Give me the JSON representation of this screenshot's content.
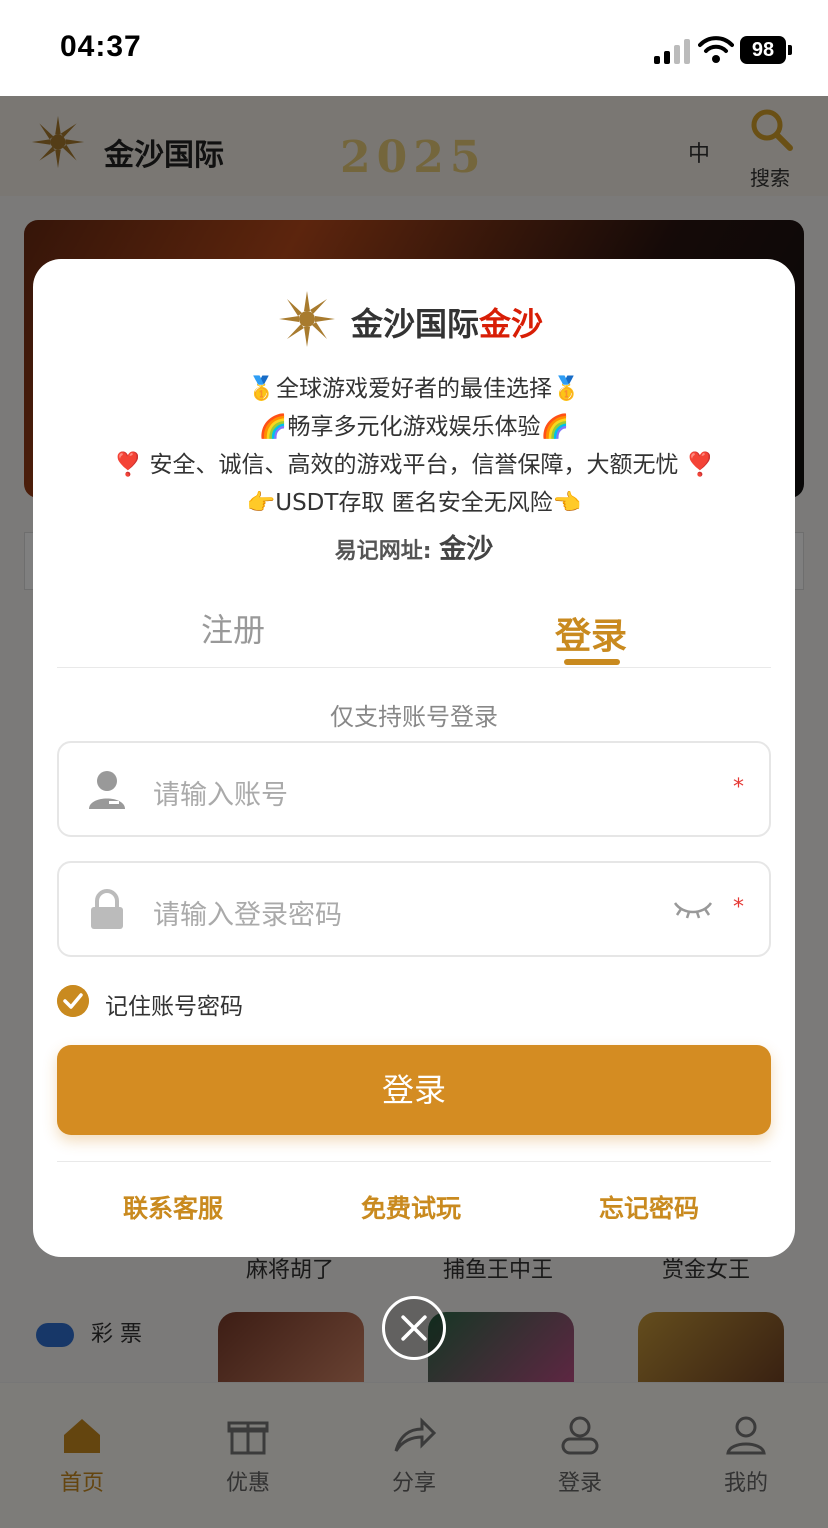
{
  "status_bar": {
    "time": "04:37",
    "battery": "98"
  },
  "app": {
    "title": "金沙国际",
    "deco_year": "2025",
    "lang": "中",
    "search_label": "搜索",
    "game_labels": [
      "麻将胡了",
      "捕鱼王中王",
      "赏金女王"
    ],
    "lottery_label": "彩 票",
    "tabs": [
      {
        "label": "首页",
        "icon": "home-icon",
        "active": true
      },
      {
        "label": "优惠",
        "icon": "gift-icon",
        "active": false
      },
      {
        "label": "分享",
        "icon": "share-icon",
        "active": false
      },
      {
        "label": "登录",
        "icon": "login-icon",
        "active": false
      },
      {
        "label": "我的",
        "icon": "profile-icon",
        "active": false
      }
    ]
  },
  "modal": {
    "brand_name": "金沙国际",
    "brand_suffix": "金沙",
    "slogans": [
      "全球游戏爱好者的最佳选择",
      "畅享多元化游戏娱乐体验",
      "安全、诚信、高效的游戏平台，信誉保障，大额无忧",
      "USDT存取 匿名安全无风险"
    ],
    "slogan_emojis": [
      "🥇",
      "🌈",
      "❣️",
      "👉",
      "👈"
    ],
    "easy_url_label": "易记网址:",
    "easy_url_value": "金沙",
    "tab_register": "注册",
    "tab_login": "登录",
    "hint": "仅支持账号登录",
    "account_placeholder": "请输入账号",
    "password_placeholder": "请输入登录密码",
    "required_mark": "*",
    "remember_label": "记住账号密码",
    "remember_checked": true,
    "login_button": "登录",
    "links": [
      "联系客服",
      "免费试玩",
      "忘记密码"
    ]
  },
  "colors": {
    "accent": "#c98a1f",
    "button": "#d48c22",
    "brand_red": "#d81e06",
    "required": "#e53935"
  }
}
